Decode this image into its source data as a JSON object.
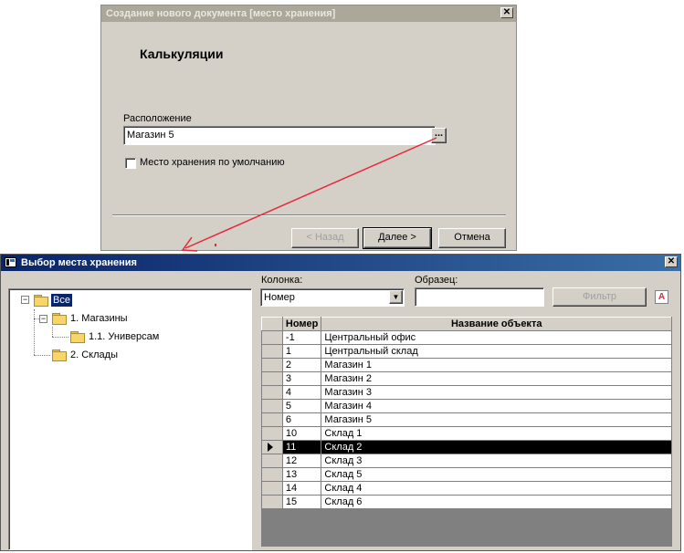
{
  "dialog1": {
    "title": "Создание нового документа [место хранения]",
    "heading": "Калькуляции",
    "location_label": "Расположение",
    "location_value": "Магазин 5",
    "browse_label": "...",
    "default_checkbox_label": "Место хранения по умолчанию",
    "default_checked": false,
    "back_label": "< Назад",
    "next_label": "Далее >",
    "cancel_label": "Отмена",
    "close_label": "✕"
  },
  "dialog2": {
    "title": "Выбор места хранения",
    "close_label": "✕",
    "tree": [
      {
        "label": "Все",
        "selected": true
      },
      {
        "label": "1. Магазины"
      },
      {
        "label": "1.1. Универсам"
      },
      {
        "label": "2. Склады"
      }
    ],
    "column_label": "Колонка:",
    "column_value": "Номер",
    "sample_label": "Образец:",
    "sample_value": "",
    "filter_label": "Фильтр",
    "clear_filter_glyph": "A",
    "grid": {
      "headers": [
        "Номер",
        "Название объекта"
      ],
      "rows": [
        [
          "-1",
          "Центральный офис"
        ],
        [
          "1",
          "Центральный склад"
        ],
        [
          "2",
          "Магазин 1"
        ],
        [
          "3",
          "Магазин 2"
        ],
        [
          "4",
          "Магазин 3"
        ],
        [
          "5",
          "Магазин 4"
        ],
        [
          "6",
          "Магазин 5"
        ],
        [
          "10",
          "Склад 1"
        ],
        [
          "11",
          "Склад 2"
        ],
        [
          "12",
          "Склад 3"
        ],
        [
          "13",
          "Склад 5"
        ],
        [
          "14",
          "Склад 4"
        ],
        [
          "15",
          "Склад 6"
        ]
      ],
      "selected_row": 8
    }
  },
  "colors": {
    "titlebar_active": "#0a246a",
    "titlebar_inactive": "#aca899",
    "arrow": "#e8283a",
    "selection": "#000000"
  }
}
